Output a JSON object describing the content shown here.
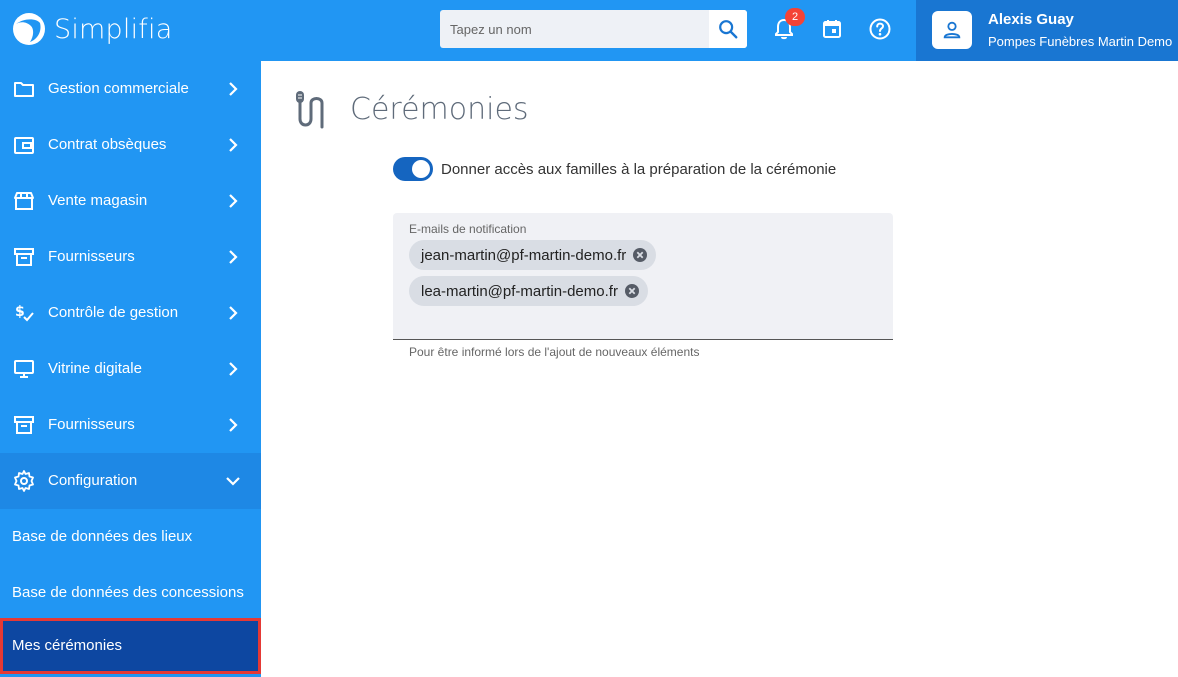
{
  "app": {
    "name": "Simplifia"
  },
  "header": {
    "search": {
      "placeholder": "Tapez un nom",
      "value": ""
    },
    "notifications": {
      "count": "2"
    },
    "user": {
      "name": "Alexis Guay",
      "company": "Pompes Funèbres Martin Demo"
    }
  },
  "sidebar": {
    "items": [
      {
        "label": "Gestion commerciale",
        "icon": "folder-icon"
      },
      {
        "label": "Contrat obsèques",
        "icon": "wallet-icon"
      },
      {
        "label": "Vente magasin",
        "icon": "store-icon"
      },
      {
        "label": "Fournisseurs",
        "icon": "archive-icon"
      },
      {
        "label": "Contrôle de gestion",
        "icon": "dollar-check-icon"
      },
      {
        "label": "Vitrine digitale",
        "icon": "monitor-icon"
      },
      {
        "label": "Fournisseurs",
        "icon": "archive-icon"
      },
      {
        "label": "Configuration",
        "icon": "gear-icon"
      }
    ],
    "subitems": [
      {
        "label": "Base de données des lieux"
      },
      {
        "label": "Base de données des concessions"
      },
      {
        "label": "Mes cérémonies"
      }
    ]
  },
  "main": {
    "title": "Cérémonies",
    "toggle": {
      "label": "Donner accès aux familles à la préparation de la cérémonie",
      "on": true
    },
    "emails": {
      "label": "E-mails de notification",
      "chips": [
        "jean-martin@pf-martin-demo.fr",
        "lea-martin@pf-martin-demo.fr"
      ],
      "hint": "Pour être informé lors de l'ajout de nouveaux éléments"
    }
  },
  "colors": {
    "primary": "#2196f3",
    "user_area": "#1976d2",
    "active_item": "#0d47a1",
    "highlight_border": "#e53935",
    "toggle": "#1565c0"
  }
}
